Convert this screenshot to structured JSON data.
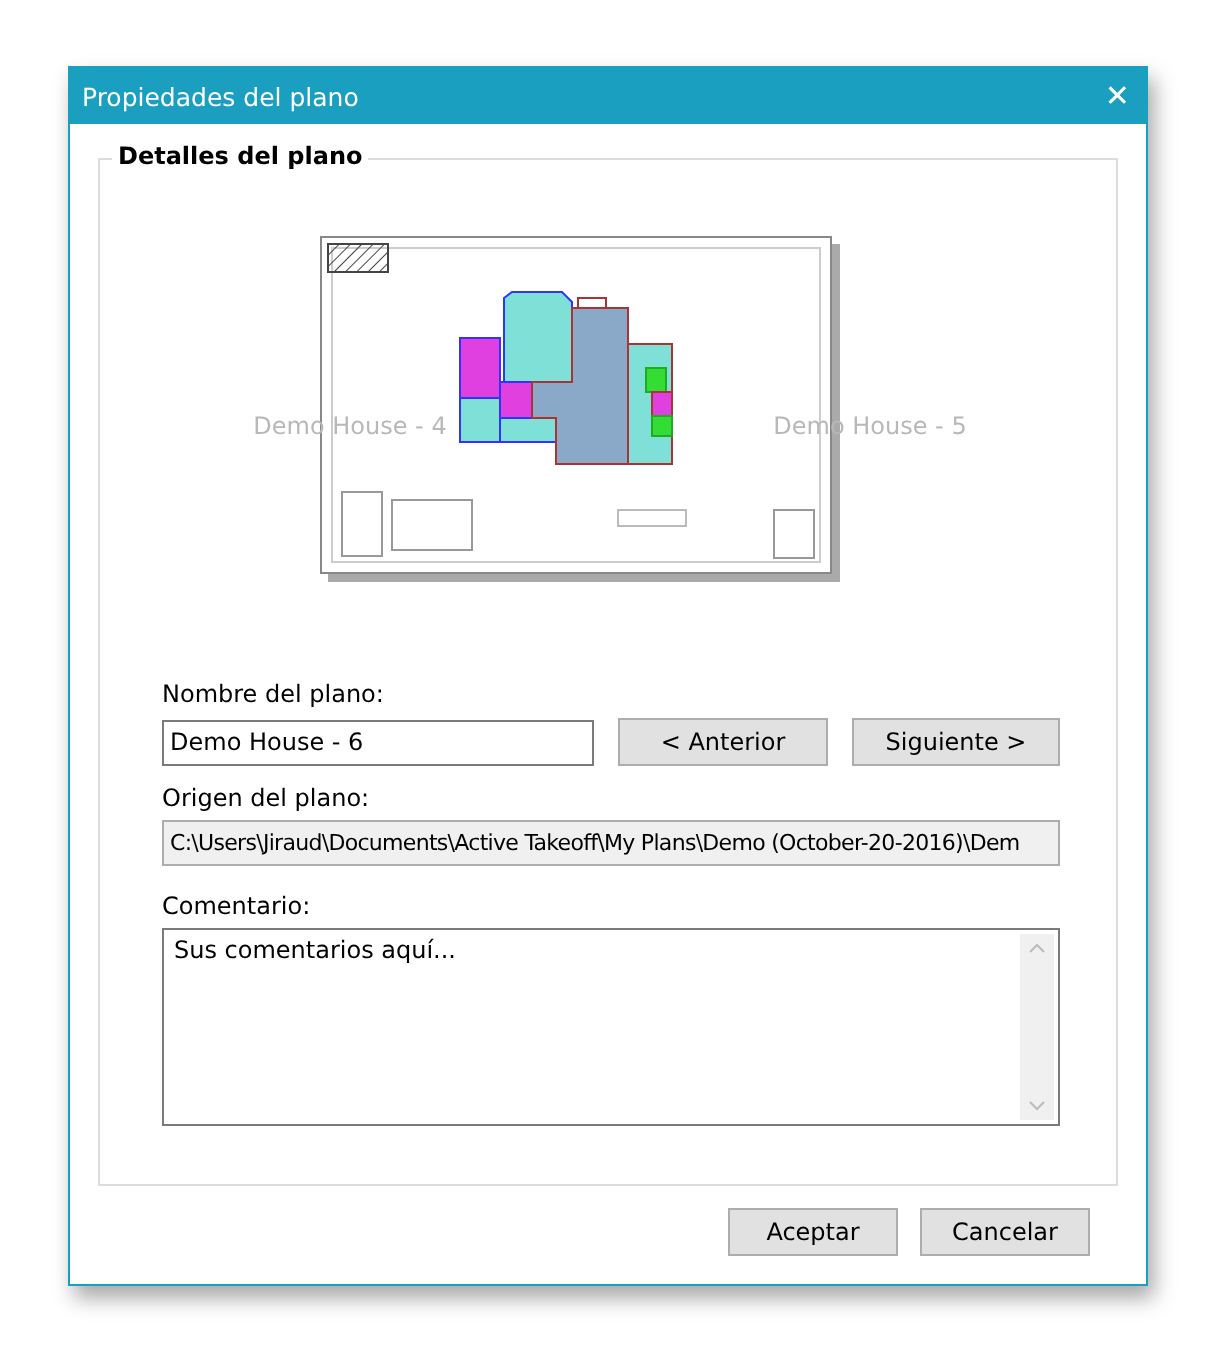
{
  "window": {
    "title": "Propiedades del plano",
    "close_glyph": "✕"
  },
  "background_items": [
    {
      "label": "Demo House - 4"
    },
    {
      "label": "Demo House - 5"
    }
  ],
  "group": {
    "title": "Detalles del plano"
  },
  "name_field": {
    "label": "Nombre del plano:",
    "value": "Demo House - 6"
  },
  "nav_buttons": [
    {
      "label": "< Anterior"
    },
    {
      "label": "Siguiente >"
    }
  ],
  "origin_field": {
    "label": "Origen del plano:",
    "value": "C:\\Users\\Jiraud\\Documents\\Active Takeoff\\My Plans\\Demo (October-20-2016)\\Dem",
    "disabled": true
  },
  "comment_field": {
    "label": "Comentario:",
    "value": "Sus comentarios aquí..."
  },
  "buttons": [
    {
      "label": "Aceptar"
    },
    {
      "label": "Cancelar"
    }
  ]
}
